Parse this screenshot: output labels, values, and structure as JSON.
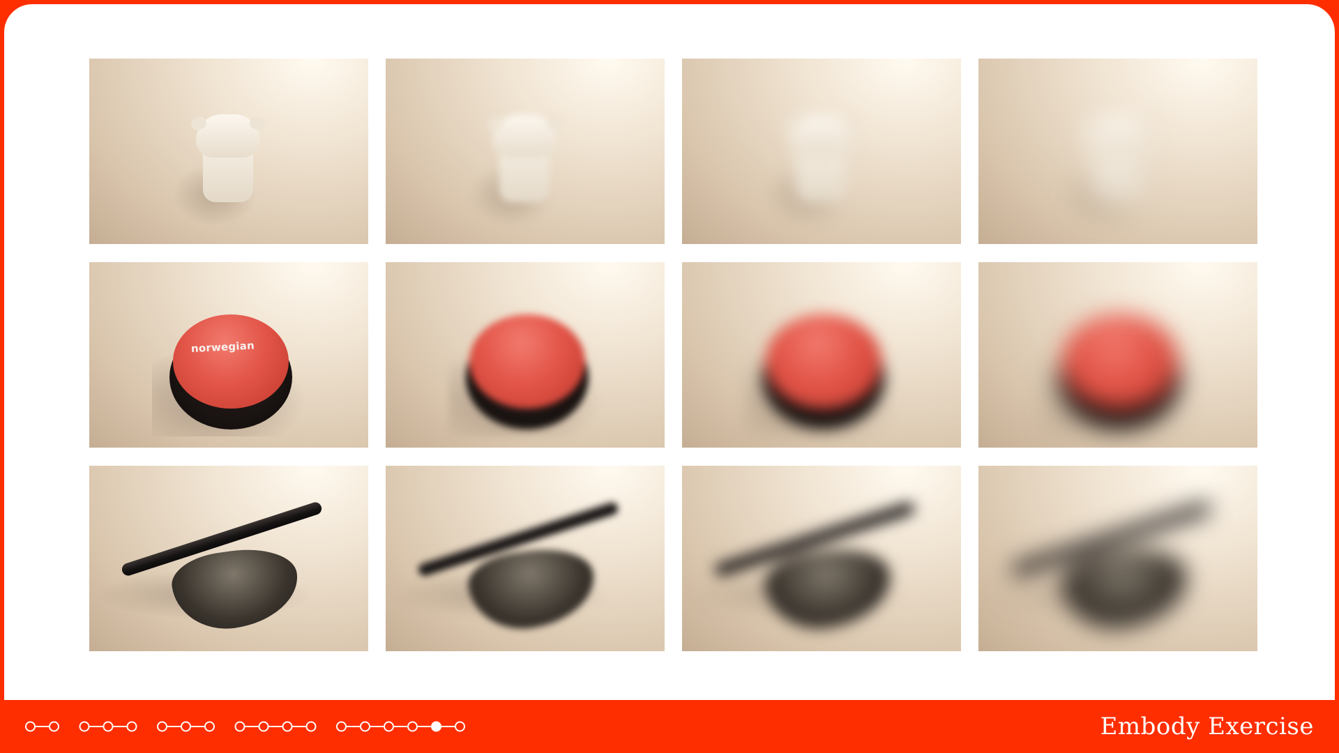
{
  "footer": {
    "brand_text": "Embody Exercise"
  },
  "progress": {
    "groups": [
      2,
      3,
      3,
      4,
      6
    ],
    "active_index": 16
  },
  "gallery": {
    "rows": [
      {
        "subject": "pig-figurine",
        "labels": [
          "",
          "",
          "",
          ""
        ]
      },
      {
        "subject": "red-button",
        "labels": [
          "norwegian",
          "",
          "",
          ""
        ]
      },
      {
        "subject": "metal-rod",
        "labels": [
          "",
          "",
          "",
          ""
        ]
      }
    ],
    "blur_levels": [
      1,
      2,
      3,
      4
    ]
  },
  "colors": {
    "accent": "#ff2e00",
    "card": "#ffffff"
  }
}
